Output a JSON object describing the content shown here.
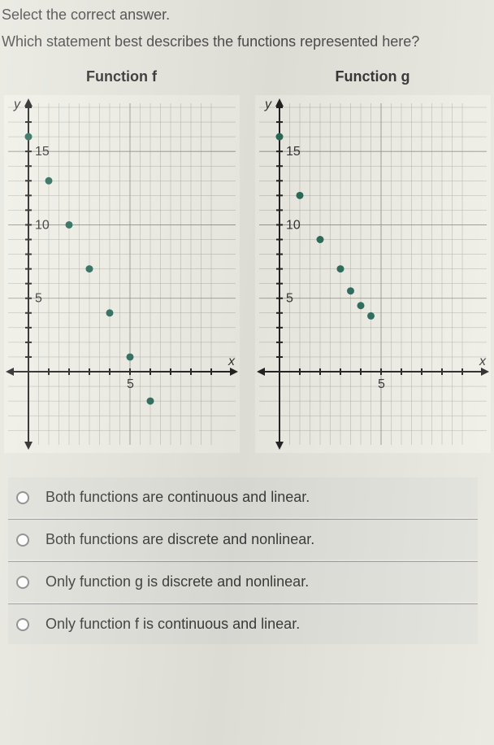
{
  "instruction": "Select the correct answer.",
  "question": "Which statement best describes the functions represented here?",
  "chart_data": [
    {
      "type": "scatter",
      "title": "Function f",
      "xlabel": "x",
      "ylabel": "y",
      "xlim": [
        -1,
        9
      ],
      "ylim": [
        -4,
        18
      ],
      "x_ticks": [
        5
      ],
      "y_ticks": [
        5,
        10,
        15
      ],
      "series": [
        {
          "name": "f",
          "points": [
            [
              0,
              16
            ],
            [
              1,
              13
            ],
            [
              2,
              10
            ],
            [
              3,
              7
            ],
            [
              4,
              4
            ],
            [
              5,
              1
            ],
            [
              6,
              -2
            ]
          ]
        }
      ]
    },
    {
      "type": "scatter",
      "title": "Function g",
      "xlabel": "x",
      "ylabel": "y",
      "xlim": [
        -1,
        9
      ],
      "ylim": [
        -4,
        18
      ],
      "x_ticks": [
        5
      ],
      "y_ticks": [
        5,
        10,
        15
      ],
      "series": [
        {
          "name": "g",
          "points": [
            [
              0,
              16
            ],
            [
              1,
              12
            ],
            [
              2,
              9
            ],
            [
              3,
              7
            ],
            [
              3.5,
              5.5
            ],
            [
              4,
              4.5
            ],
            [
              4.5,
              3.8
            ]
          ]
        }
      ]
    }
  ],
  "options": [
    {
      "label": "Both functions are continuous and linear."
    },
    {
      "label": "Both functions are discrete and nonlinear."
    },
    {
      "label": "Only function g is discrete and nonlinear."
    },
    {
      "label": "Only function f is continuous and linear."
    }
  ]
}
